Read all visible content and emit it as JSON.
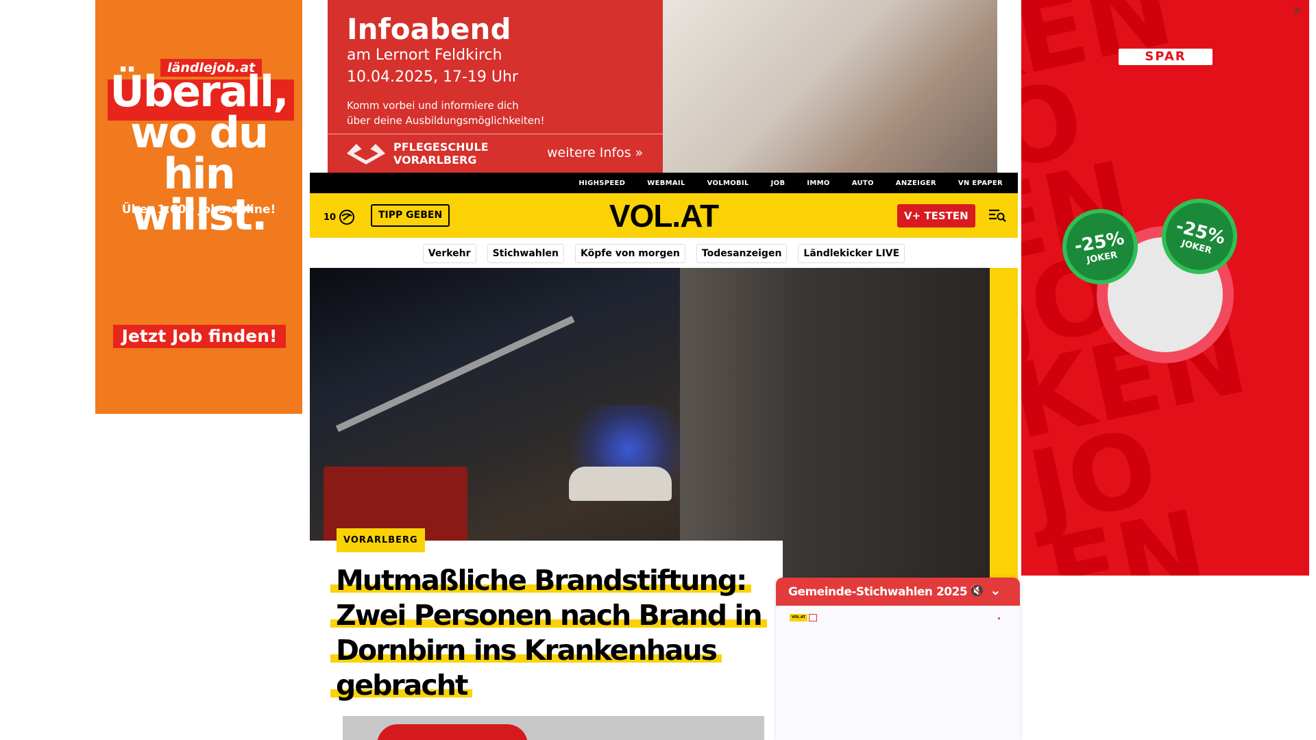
{
  "left_ad": {
    "brand": "ländlejob.at",
    "headline": "Überall,\nwo du hin\nwillst.",
    "subline": "Über 1.600 Jobs online!",
    "cta": "Jetzt Job finden!"
  },
  "top_ad": {
    "title": "Infoabend",
    "line1": "am Lernort Feldkirch",
    "line2": "10.04.2025, 17-19 Uhr",
    "desc1": "Komm vorbei und informiere dich",
    "desc2": "über deine Ausbildungsmöglichkeiten!",
    "school": "PFLEGESCHULE\nVORARLBERG",
    "more": "weitere Infos »"
  },
  "topnav": [
    "HIGHSPEED",
    "WEBMAIL",
    "VOLMOBIL",
    "JOB",
    "IMMO",
    "AUTO",
    "ANZEIGER",
    "VN EPAPER"
  ],
  "header": {
    "count": "10",
    "tipp": "TIPP GEBEN",
    "logo": "VOL.AT",
    "vplus": "V+ TESTEN"
  },
  "topics": [
    "Verkehr",
    "Stichwahlen",
    "Köpfe von morgen",
    "Todesanzeigen",
    "Ländlekicker LIVE"
  ],
  "article": {
    "category": "VORARLBERG",
    "headline": "Mutmaßliche Brandstiftung: Zwei Personen nach Brand in Dornbirn ins Krankenhaus gebracht"
  },
  "right_ad": {
    "bg_text": "KEN JO\nEN JOB\nKEN JO\nEN JOB",
    "brand": "SPAR",
    "badge": "-25%",
    "badge_sub": "JOKER"
  },
  "widget": {
    "title": "Gemeinde-Stichwahlen 2025",
    "mini_logo": "VOL.AT"
  },
  "colors": {
    "brand_yellow": "#fad206",
    "vplus_red": "#d81b20",
    "widget_red": "#e33b3b",
    "left_ad_orange": "#f07a1d",
    "spar_red": "#e3101a"
  }
}
